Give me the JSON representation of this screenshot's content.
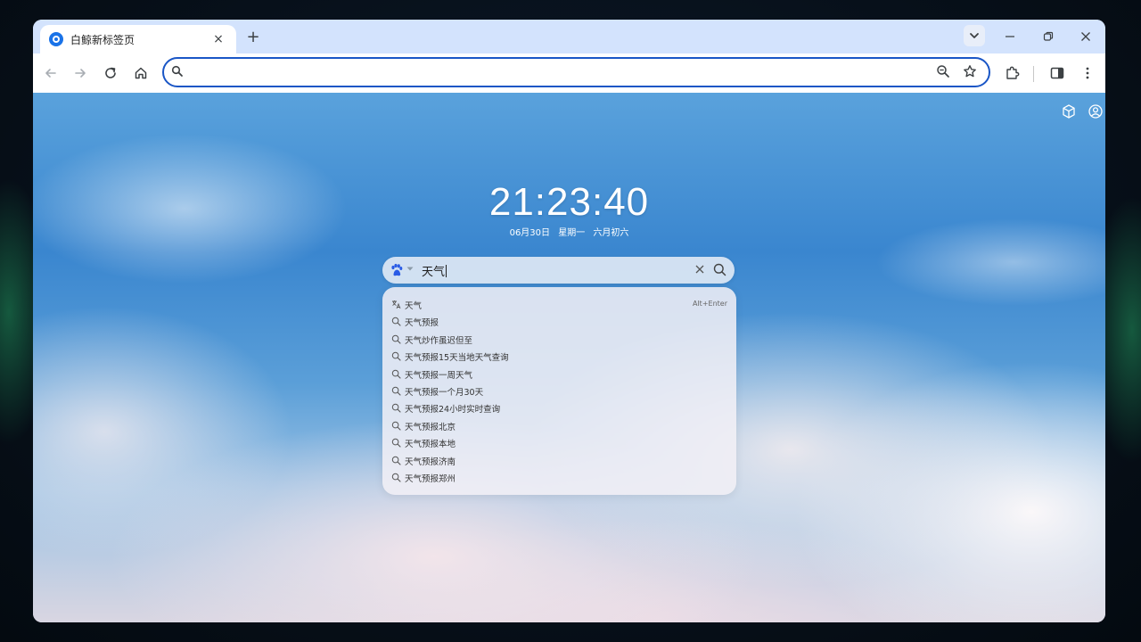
{
  "tab": {
    "title": "白鲸新标签页",
    "close_label": "×",
    "new_tab_label": "+"
  },
  "window_controls": {
    "minimize": "—",
    "restore": "❐",
    "close": "✕"
  },
  "omnibox": {
    "value": "",
    "placeholder": ""
  },
  "page": {
    "clock": "21:23:40",
    "date": {
      "day": "06月30日",
      "weekday": "星期一",
      "lunar": "六月初六"
    },
    "search": {
      "query": "天气",
      "engine_icon": "baidu-paw-icon"
    },
    "suggestions": [
      {
        "text": "天气",
        "icon": "translate-icon",
        "shortcut": "Alt+Enter"
      },
      {
        "text": "天气预报",
        "icon": "search-icon"
      },
      {
        "text": "天气炒作虽迟但至",
        "icon": "search-icon"
      },
      {
        "text": "天气预报15天当地天气查询",
        "icon": "search-icon"
      },
      {
        "text": "天气预报一周天气",
        "icon": "search-icon"
      },
      {
        "text": "天气预报一个月30天",
        "icon": "search-icon"
      },
      {
        "text": "天气预报24小时实时查询",
        "icon": "search-icon"
      },
      {
        "text": "天气预报北京",
        "icon": "search-icon"
      },
      {
        "text": "天气预报本地",
        "icon": "search-icon"
      },
      {
        "text": "天气预报济南",
        "icon": "search-icon"
      },
      {
        "text": "天气预报郑州",
        "icon": "search-icon"
      }
    ]
  },
  "colors": {
    "omnibox_border": "#1a56c6",
    "tabstrip_bg": "#d3e3fd",
    "baidu_blue": "#2a5ce6"
  }
}
